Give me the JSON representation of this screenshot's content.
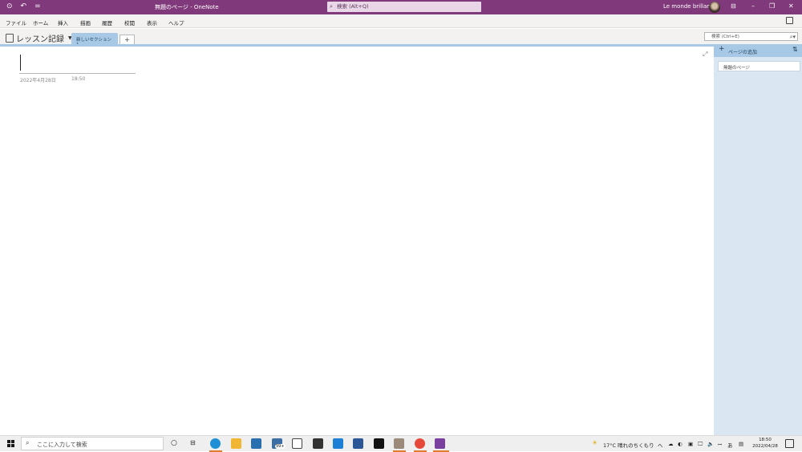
{
  "titlebar": {
    "back_icon": "back-circle-icon",
    "undo_icon": "undo-icon",
    "qat_icon": "customize-qat-icon",
    "title": "無題のページ - OneNote",
    "search_placeholder": "検索 (Alt+Q)",
    "user_name": "Le monde brillant",
    "bg_color": "#80397b"
  },
  "menu": {
    "items": [
      "ファイル",
      "ホーム",
      "挿入",
      "描画",
      "履歴",
      "校閲",
      "表示",
      "ヘルプ"
    ]
  },
  "notebook": {
    "name": "レッスン記録",
    "section_tab": "新しいセクション 1",
    "add_tab": "+",
    "search_placeholder": "検索 (Ctrl+E)"
  },
  "page": {
    "date": "2022年4月28日",
    "time": "18:50"
  },
  "pagepane": {
    "add_page": "ページの追加",
    "pages": [
      "無題のページ"
    ]
  },
  "taskbar": {
    "search_placeholder": "ここに入力して検索",
    "weather": "17°C 晴れのちくもり",
    "tray": "へ",
    "ime": "あ",
    "clock_time": "18:50",
    "clock_date": "2022/04/28",
    "mail_badge": "99+"
  }
}
